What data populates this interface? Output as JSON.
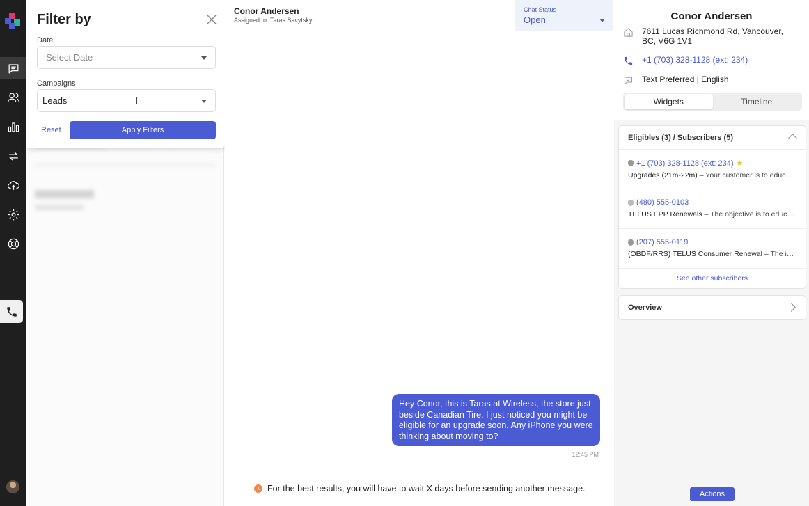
{
  "filter": {
    "title": "Filter by",
    "date_label": "Date",
    "date_placeholder": "Select Date",
    "campaigns_label": "Campaigns",
    "campaigns_value": "Leads",
    "reset_label": "Reset",
    "apply_label": "Apply Filters"
  },
  "chat": {
    "contact_name": "Conor Andersen",
    "assigned": "Assigned to: Taras Savytskyi",
    "status_label": "Chat Status",
    "status_value": "Open",
    "message": "Hey Conor, this is Taras at Wireless, the store just beside Canadian Tire. I just noticed you might be eligible for an upgrade soon. Any iPhone you were thinking about moving to?",
    "message_time": "12:45 PM",
    "notice": "For the best results, you will have to wait X days before sending another message."
  },
  "contact": {
    "name": "Conor Andersen",
    "address": "7611 Lucas Richmond Rd, Vancouver, BC, V6G 1V1",
    "phone": "+1 (703) 328-1128 (ext: 234)",
    "preference": "Text Preferred | English",
    "tabs": [
      "Widgets",
      "Timeline"
    ]
  },
  "eligibles": {
    "header": "Eligibles (3) / Subscribers (5)",
    "items": [
      {
        "phone": "+1 (703) 328-1128 (ext: 234)",
        "campaign": "Upgrades (21m-22m)",
        "detail": " – Your customer is to educ…"
      },
      {
        "phone": "(480) 555-0103",
        "campaign": "TELUS EPP Renewals",
        "detail": " – The objective is to educat…"
      },
      {
        "phone": "(207) 555-0119",
        "campaign": "(OBDF/RRS) TELUS Consumer Renewal",
        "detail": " – The int…"
      }
    ],
    "see_other": "See other subscribers"
  },
  "overview_label": "Overview",
  "actions_label": "Actions",
  "colors": {
    "accent": "#4a5bd4",
    "rail": "#1f1f1f",
    "notice_dot": "#f0884a"
  }
}
